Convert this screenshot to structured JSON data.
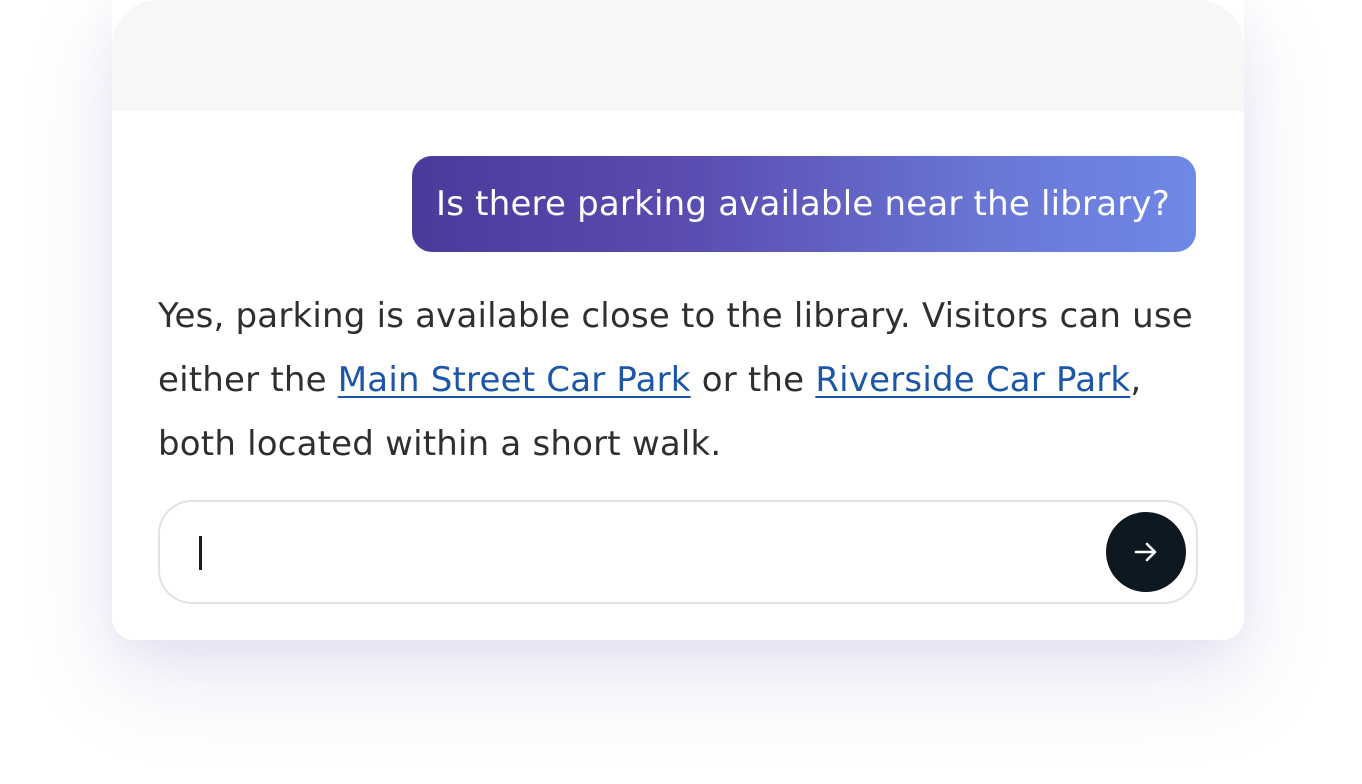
{
  "chat": {
    "user_message": "Is there parking available near the library?",
    "bot_message": {
      "part1": "Yes, parking is available close to the library. Visitors can use either the ",
      "link1": "Main Street Car Park",
      "part2": " or the ",
      "link2": "Riverside Car Park",
      "part3": ", both located within a short walk."
    }
  },
  "composer": {
    "input_value": "",
    "send_icon": "arrow-right-icon"
  },
  "colors": {
    "user_bubble_start": "#4b3a9a",
    "user_bubble_end": "#6f88e6",
    "link": "#1b56a8",
    "send_button": "#0d1820"
  }
}
